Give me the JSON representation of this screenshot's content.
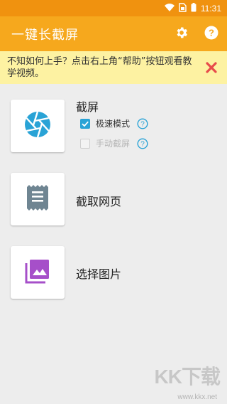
{
  "statusbar": {
    "time": "11:31",
    "icons": [
      "wifi-icon",
      "sim-icon",
      "battery-icon"
    ]
  },
  "appbar": {
    "title": "一键长截屏",
    "settings_icon": "gear-icon",
    "help_icon": "help-icon"
  },
  "tip": {
    "text": "不知如何上手？点击右上角“帮助”按钮观看教学视频。",
    "close_icon": "close-icon"
  },
  "items": [
    {
      "label": "截屏",
      "icon": "aperture-icon",
      "options": [
        {
          "label": "极速模式",
          "checked": true,
          "enabled": true
        },
        {
          "label": "手动截屏",
          "checked": false,
          "enabled": false
        }
      ]
    },
    {
      "label": "截取网页",
      "icon": "webpage-icon"
    },
    {
      "label": "选择图片",
      "icon": "gallery-icon"
    }
  ],
  "watermark": {
    "logo": "KK下载",
    "url": "www.kkx.net"
  },
  "colors": {
    "statusbar": "#f0920f",
    "appbar": "#f6a81d",
    "tip_background": "#fdf2a2",
    "close": "#e74b4b",
    "accent_blue": "#29a3d6",
    "webpage_icon": "#6f8592",
    "gallery_icon": "#a64fc9"
  }
}
